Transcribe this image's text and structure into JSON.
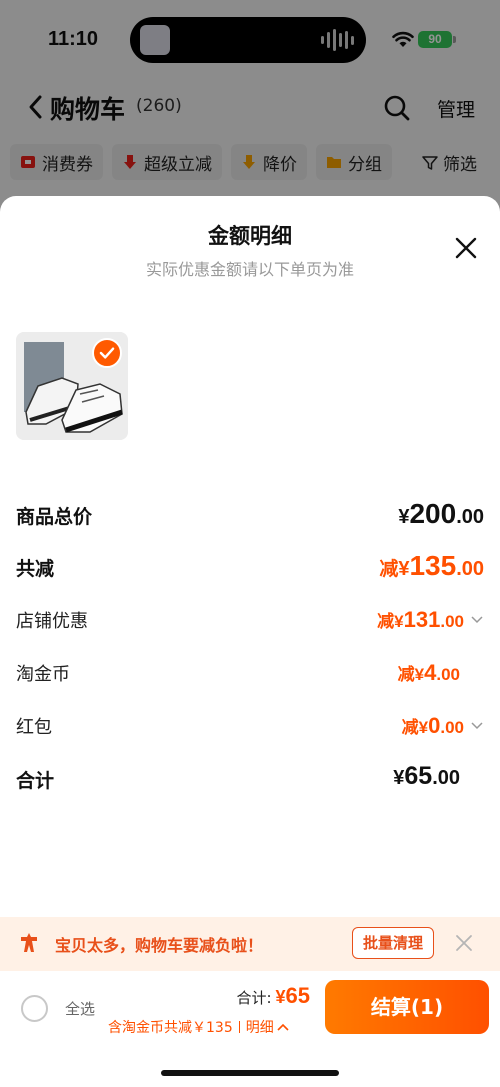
{
  "status": {
    "time": "11:10",
    "battery": "90"
  },
  "nav": {
    "title": "购物车",
    "count": "(260)",
    "manage": "管理"
  },
  "chips": [
    {
      "label": "消费券",
      "icon": "coupon-icon"
    },
    {
      "label": "超级立减",
      "icon": "down-arrow-icon"
    },
    {
      "label": "降价",
      "icon": "price-drop-icon"
    },
    {
      "label": "分组",
      "icon": "folder-icon"
    }
  ],
  "filter": {
    "label": "筛选"
  },
  "sheet": {
    "title": "金额明细",
    "subtitle": "实际优惠金额请以下单页为准"
  },
  "breakdown": {
    "goods_total": {
      "label": "商品总价",
      "cur": "¥",
      "int": "200",
      "dec": ".00"
    },
    "total_discount": {
      "label": "共减",
      "prefix": "减",
      "cur": "¥",
      "int": "135",
      "dec": ".00"
    },
    "store_discount": {
      "label": "店铺优惠",
      "prefix": "减",
      "cur": "¥",
      "int": "131",
      "dec": ".00"
    },
    "coins": {
      "label": "淘金币",
      "prefix": "减",
      "cur": "¥",
      "int": "4",
      "dec": ".00"
    },
    "red_packet": {
      "label": "红包",
      "prefix": "减",
      "cur": "¥",
      "int": "0",
      "dec": ".00"
    },
    "sum": {
      "label": "合计",
      "cur": "¥",
      "int": "65",
      "dec": ".00"
    }
  },
  "banner": {
    "text": "宝贝太多，购物车要减负啦！",
    "button": "批量清理"
  },
  "bottom": {
    "select_all": "全选",
    "total_label": "合计:",
    "total_cur": "¥",
    "total_value": "65",
    "detail_text": "含淘金币共减￥135",
    "detail_link": "明细",
    "checkout": "结算(1)"
  },
  "colors": {
    "accent": "#ff5000",
    "banner_bg": "#fff1e6",
    "check": "#34c759"
  }
}
